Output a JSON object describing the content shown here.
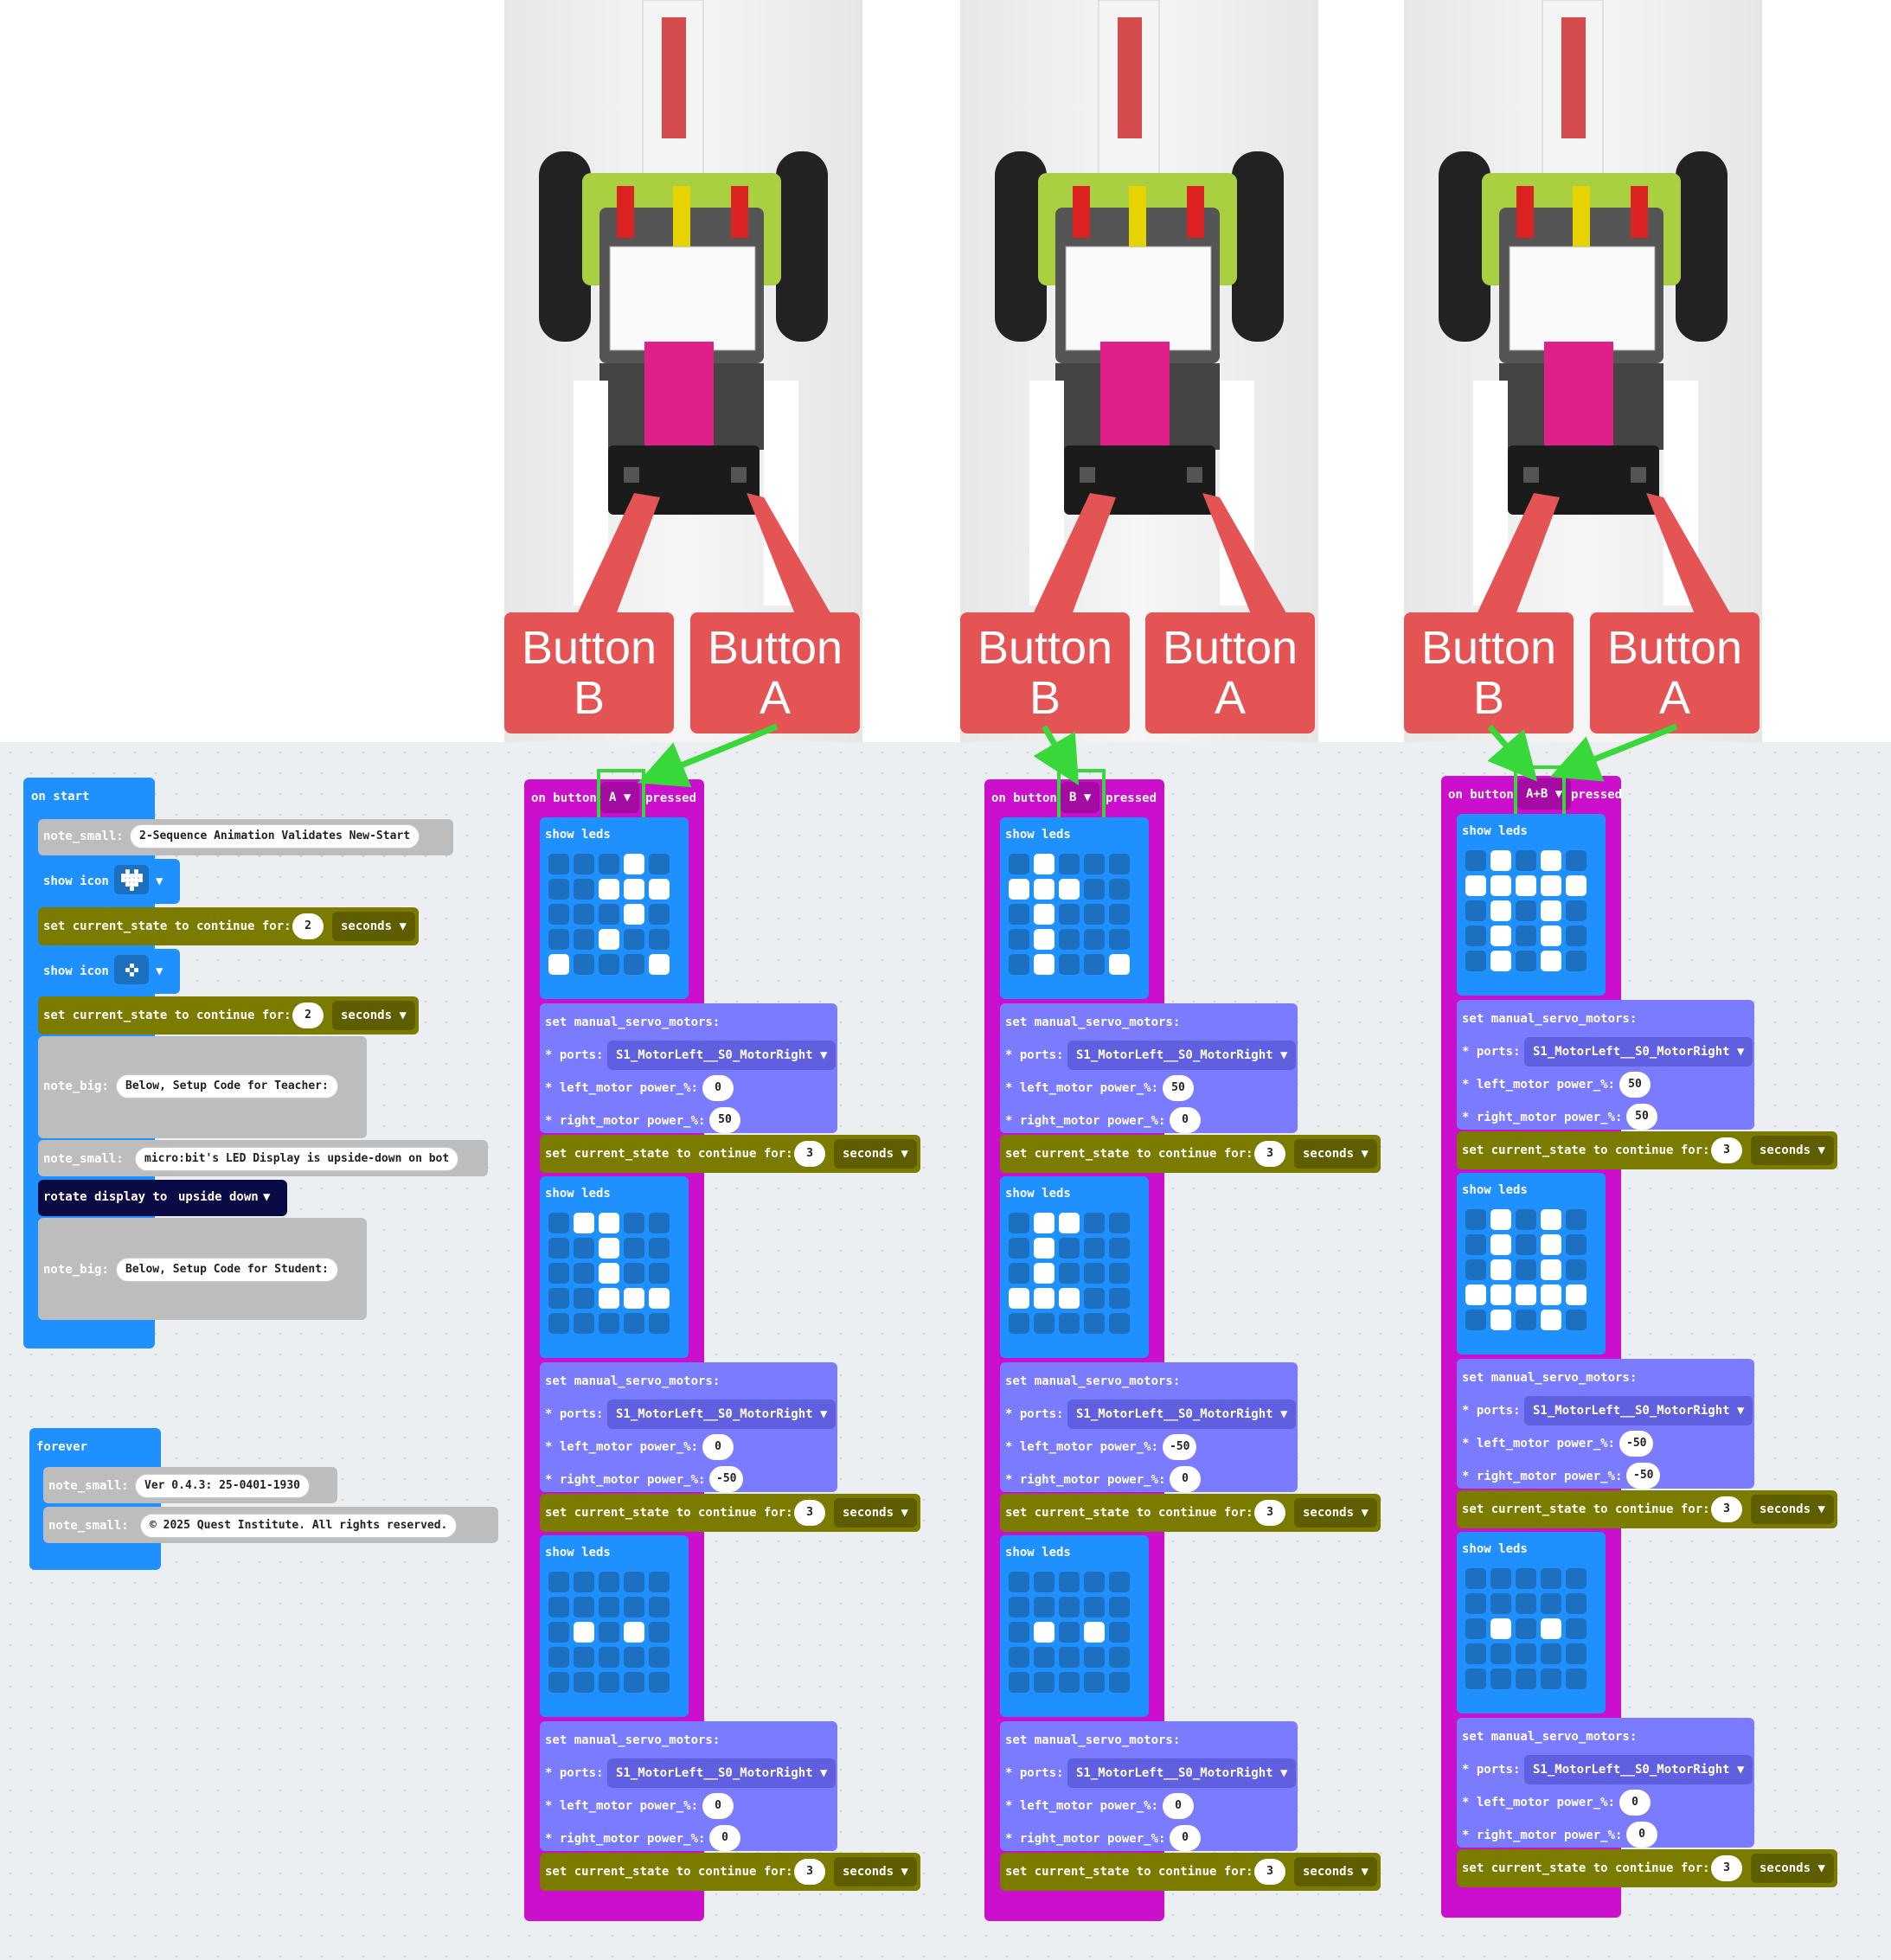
{
  "callouts": {
    "button_b": "Button B",
    "button_a": "Button A"
  },
  "on_start": {
    "header": "on start",
    "note_small_1": {
      "label": "note_small:",
      "text": "2-Sequence Animation Validates New-Start"
    },
    "show_icon_label": "show icon",
    "set_state_label": "set current_state to continue for:",
    "state_1_value": "2",
    "state_2_value": "2",
    "seconds_label": "seconds",
    "note_big_1": {
      "label": "note_big:",
      "text": "Below, Setup Code for Teacher:"
    },
    "note_small_2": {
      "label": "note_small:",
      "text": "micro:bit's LED Display is upside-down on bot"
    },
    "rotate": {
      "label": "rotate display to",
      "value": "upside down"
    },
    "note_big_2": {
      "label": "note_big:",
      "text": "Below, Setup Code for Student:"
    }
  },
  "forever": {
    "header": "forever",
    "note_1": {
      "label": "note_small:",
      "text": "Ver 0.4.3: 25-0401-1930"
    },
    "note_2": {
      "label": "note_small:",
      "text": "© 2025 Quest Institute. All rights reserved."
    }
  },
  "handlers": [
    {
      "prefix": "on button",
      "button": "A",
      "suffix": "pressed",
      "steps": [
        {
          "leds": "0001000111000100010010001",
          "left": "0",
          "right": "50",
          "secs": "3"
        },
        {
          "leds": "0110000100001000011100000",
          "left": "0",
          "right": "-50",
          "secs": "3"
        },
        {
          "leds": "0000000000010100000000000",
          "left": "0",
          "right": "0",
          "secs": "3"
        }
      ]
    },
    {
      "prefix": "on button",
      "button": "B",
      "suffix": "pressed",
      "steps": [
        {
          "leds": "0100011100010000100001001",
          "left": "50",
          "right": "0",
          "secs": "3"
        },
        {
          "leds": "0110001000010001110000000",
          "left": "-50",
          "right": "0",
          "secs": "3"
        },
        {
          "leds": "0000000000010100000000000",
          "left": "0",
          "right": "0",
          "secs": "3"
        }
      ]
    },
    {
      "prefix": "on button",
      "button": "A+B",
      "suffix": "pressed",
      "steps": [
        {
          "leds": "0101011111010100101001010",
          "left": "50",
          "right": "50",
          "secs": "3"
        },
        {
          "leds": "0101001010010101111101010",
          "left": "-50",
          "right": "-50",
          "secs": "3"
        },
        {
          "leds": "0000000000010100000000000",
          "left": "0",
          "right": "0",
          "secs": "3"
        }
      ]
    }
  ],
  "common": {
    "show_leds": "show leds",
    "servo_header": "set manual_servo_motors:",
    "ports_label": "* ports:",
    "ports_value": "S1_MotorLeft__S0_MotorRight",
    "left_label": "* left_motor power_%:",
    "right_label": "* right_motor power_%:",
    "state_label": "set current_state to continue for:",
    "seconds": "seconds"
  },
  "colors": {
    "event": "#cc0fcc",
    "loops": "#1e90ff",
    "note": "#bdbdbd",
    "state": "#7b7b00",
    "servo": "#7b7bff",
    "led": "#1e90ff",
    "rotate": "#0a0a45",
    "callout": "#e45454",
    "highlight": "#39d83a"
  }
}
